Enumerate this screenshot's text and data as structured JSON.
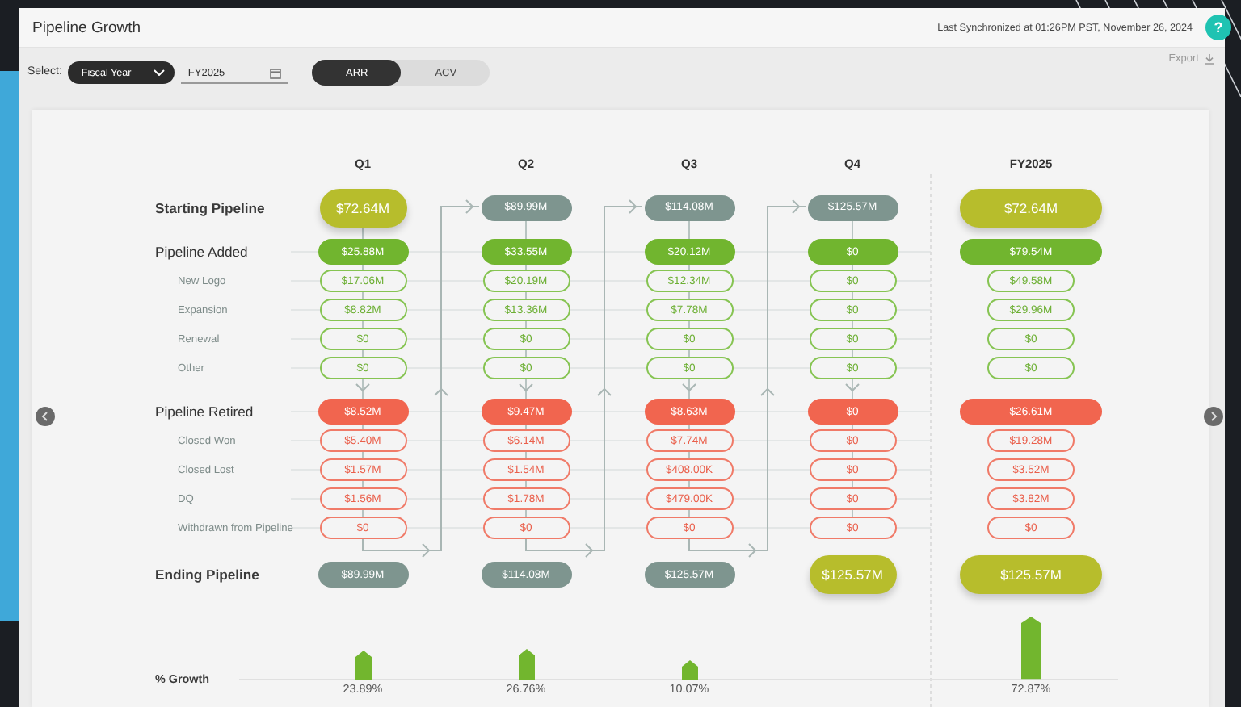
{
  "header": {
    "title": "Pipeline Growth",
    "sync": "Last Synchronized at 01:26PM PST, November 26, 2024",
    "help": "?"
  },
  "filters": {
    "label": "Select:",
    "period_type": "Fiscal Year",
    "period": "FY2025",
    "export": "Export",
    "toggle": [
      {
        "label": "ARR",
        "selected": true
      },
      {
        "label": "ACV",
        "selected": false
      }
    ]
  },
  "row_labels": {
    "starting": "Starting Pipeline",
    "added": "Pipeline Added",
    "added_items": [
      "New Logo",
      "Expansion",
      "Renewal",
      "Other"
    ],
    "retired": "Pipeline Retired",
    "retired_items": [
      "Closed Won",
      "Closed Lost",
      "DQ",
      "Withdrawn from Pipeline"
    ],
    "ending": "Ending Pipeline",
    "growth": "% Growth"
  },
  "columns": [
    {
      "kind": "quarter",
      "title": "Q1",
      "starting": {
        "value": "$72.64M",
        "kind": "highlight"
      },
      "added": "$25.88M",
      "added_items": [
        "$17.06M",
        "$8.82M",
        "$0",
        "$0"
      ],
      "retired": "$8.52M",
      "retired_items": [
        "$5.40M",
        "$1.57M",
        "$1.56M",
        "$0"
      ],
      "ending": {
        "value": "$89.99M",
        "kind": "carry"
      },
      "growth": {
        "value": "23.89%"
      }
    },
    {
      "kind": "quarter",
      "title": "Q2",
      "starting": {
        "value": "$89.99M",
        "kind": "carry"
      },
      "added": "$33.55M",
      "added_items": [
        "$20.19M",
        "$13.36M",
        "$0",
        "$0"
      ],
      "retired": "$9.47M",
      "retired_items": [
        "$6.14M",
        "$1.54M",
        "$1.78M",
        "$0"
      ],
      "ending": {
        "value": "$114.08M",
        "kind": "carry"
      },
      "growth": {
        "value": "26.76%"
      }
    },
    {
      "kind": "quarter",
      "title": "Q3",
      "starting": {
        "value": "$114.08M",
        "kind": "carry"
      },
      "added": "$20.12M",
      "added_items": [
        "$12.34M",
        "$7.78M",
        "$0",
        "$0"
      ],
      "retired": "$8.63M",
      "retired_items": [
        "$7.74M",
        "$408.00K",
        "$479.00K",
        "$0"
      ],
      "ending": {
        "value": "$125.57M",
        "kind": "carry"
      },
      "growth": {
        "value": "10.07%"
      }
    },
    {
      "kind": "quarter",
      "title": "Q4",
      "starting": {
        "value": "$125.57M",
        "kind": "carry"
      },
      "added": "$0",
      "added_items": [
        "$0",
        "$0",
        "$0",
        "$0"
      ],
      "retired": "$0",
      "retired_items": [
        "$0",
        "$0",
        "$0",
        "$0"
      ],
      "ending": {
        "value": "$125.57M",
        "kind": "highlight"
      }
    },
    {
      "kind": "total",
      "title": "FY2025",
      "starting": {
        "value": "$72.64M",
        "kind": "highlight"
      },
      "added": "$79.54M",
      "added_items": [
        "$49.58M",
        "$29.96M",
        "$0",
        "$0"
      ],
      "retired": "$26.61M",
      "retired_items": [
        "$19.28M",
        "$3.52M",
        "$3.82M",
        "$0"
      ],
      "ending": {
        "value": "$125.57M",
        "kind": "highlight"
      },
      "growth": {
        "value": "72.87%"
      }
    }
  ]
}
